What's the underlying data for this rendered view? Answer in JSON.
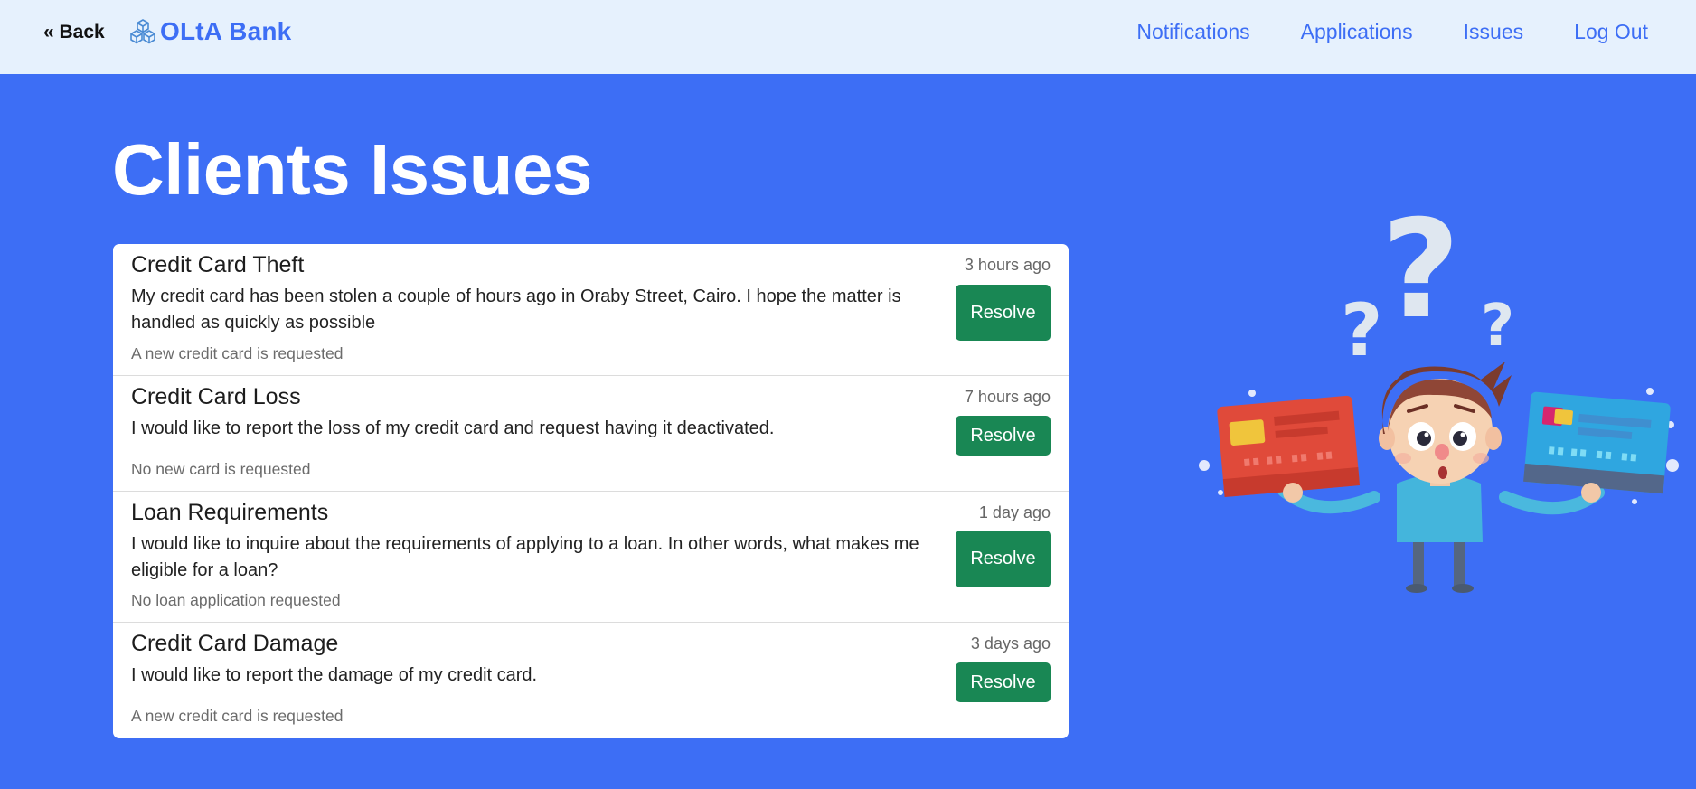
{
  "nav": {
    "back_label": "« Back",
    "brand_name": "OLtA Bank",
    "links": [
      "Notifications",
      "Applications",
      "Issues",
      "Log Out"
    ]
  },
  "page": {
    "title": "Clients Issues"
  },
  "issues": [
    {
      "title": "Credit Card Theft",
      "time": "3 hours ago",
      "description": "My credit card has been stolen a couple of hours ago in Oraby Street, Cairo. I hope the matter is handled as quickly as possible",
      "note": "A new credit card is requested",
      "action": "Resolve"
    },
    {
      "title": "Credit Card Loss",
      "time": "7 hours ago",
      "description": "I would like to report the loss of my credit card and request having it deactivated.",
      "note": "No new card is requested",
      "action": "Resolve"
    },
    {
      "title": "Loan Requirements",
      "time": "1 day ago",
      "description": "I would like to inquire about the requirements of applying to a loan. In other words, what makes me eligible for a loan?",
      "note": "No loan application requested",
      "action": "Resolve"
    },
    {
      "title": "Credit Card Damage",
      "time": "3 days ago",
      "description": "I would like to report the damage of my credit card.",
      "note": "A new credit card is requested",
      "action": "Resolve"
    }
  ],
  "icons": {
    "brand": "cubes-logo-icon",
    "illustration": "confused-person-credit-cards"
  },
  "colors": {
    "primary": "#3d6ef5",
    "navbar_bg": "#e6f1fd",
    "resolve": "#198754",
    "text_dark": "#1c1c1c",
    "muted": "#6b6b6b"
  }
}
